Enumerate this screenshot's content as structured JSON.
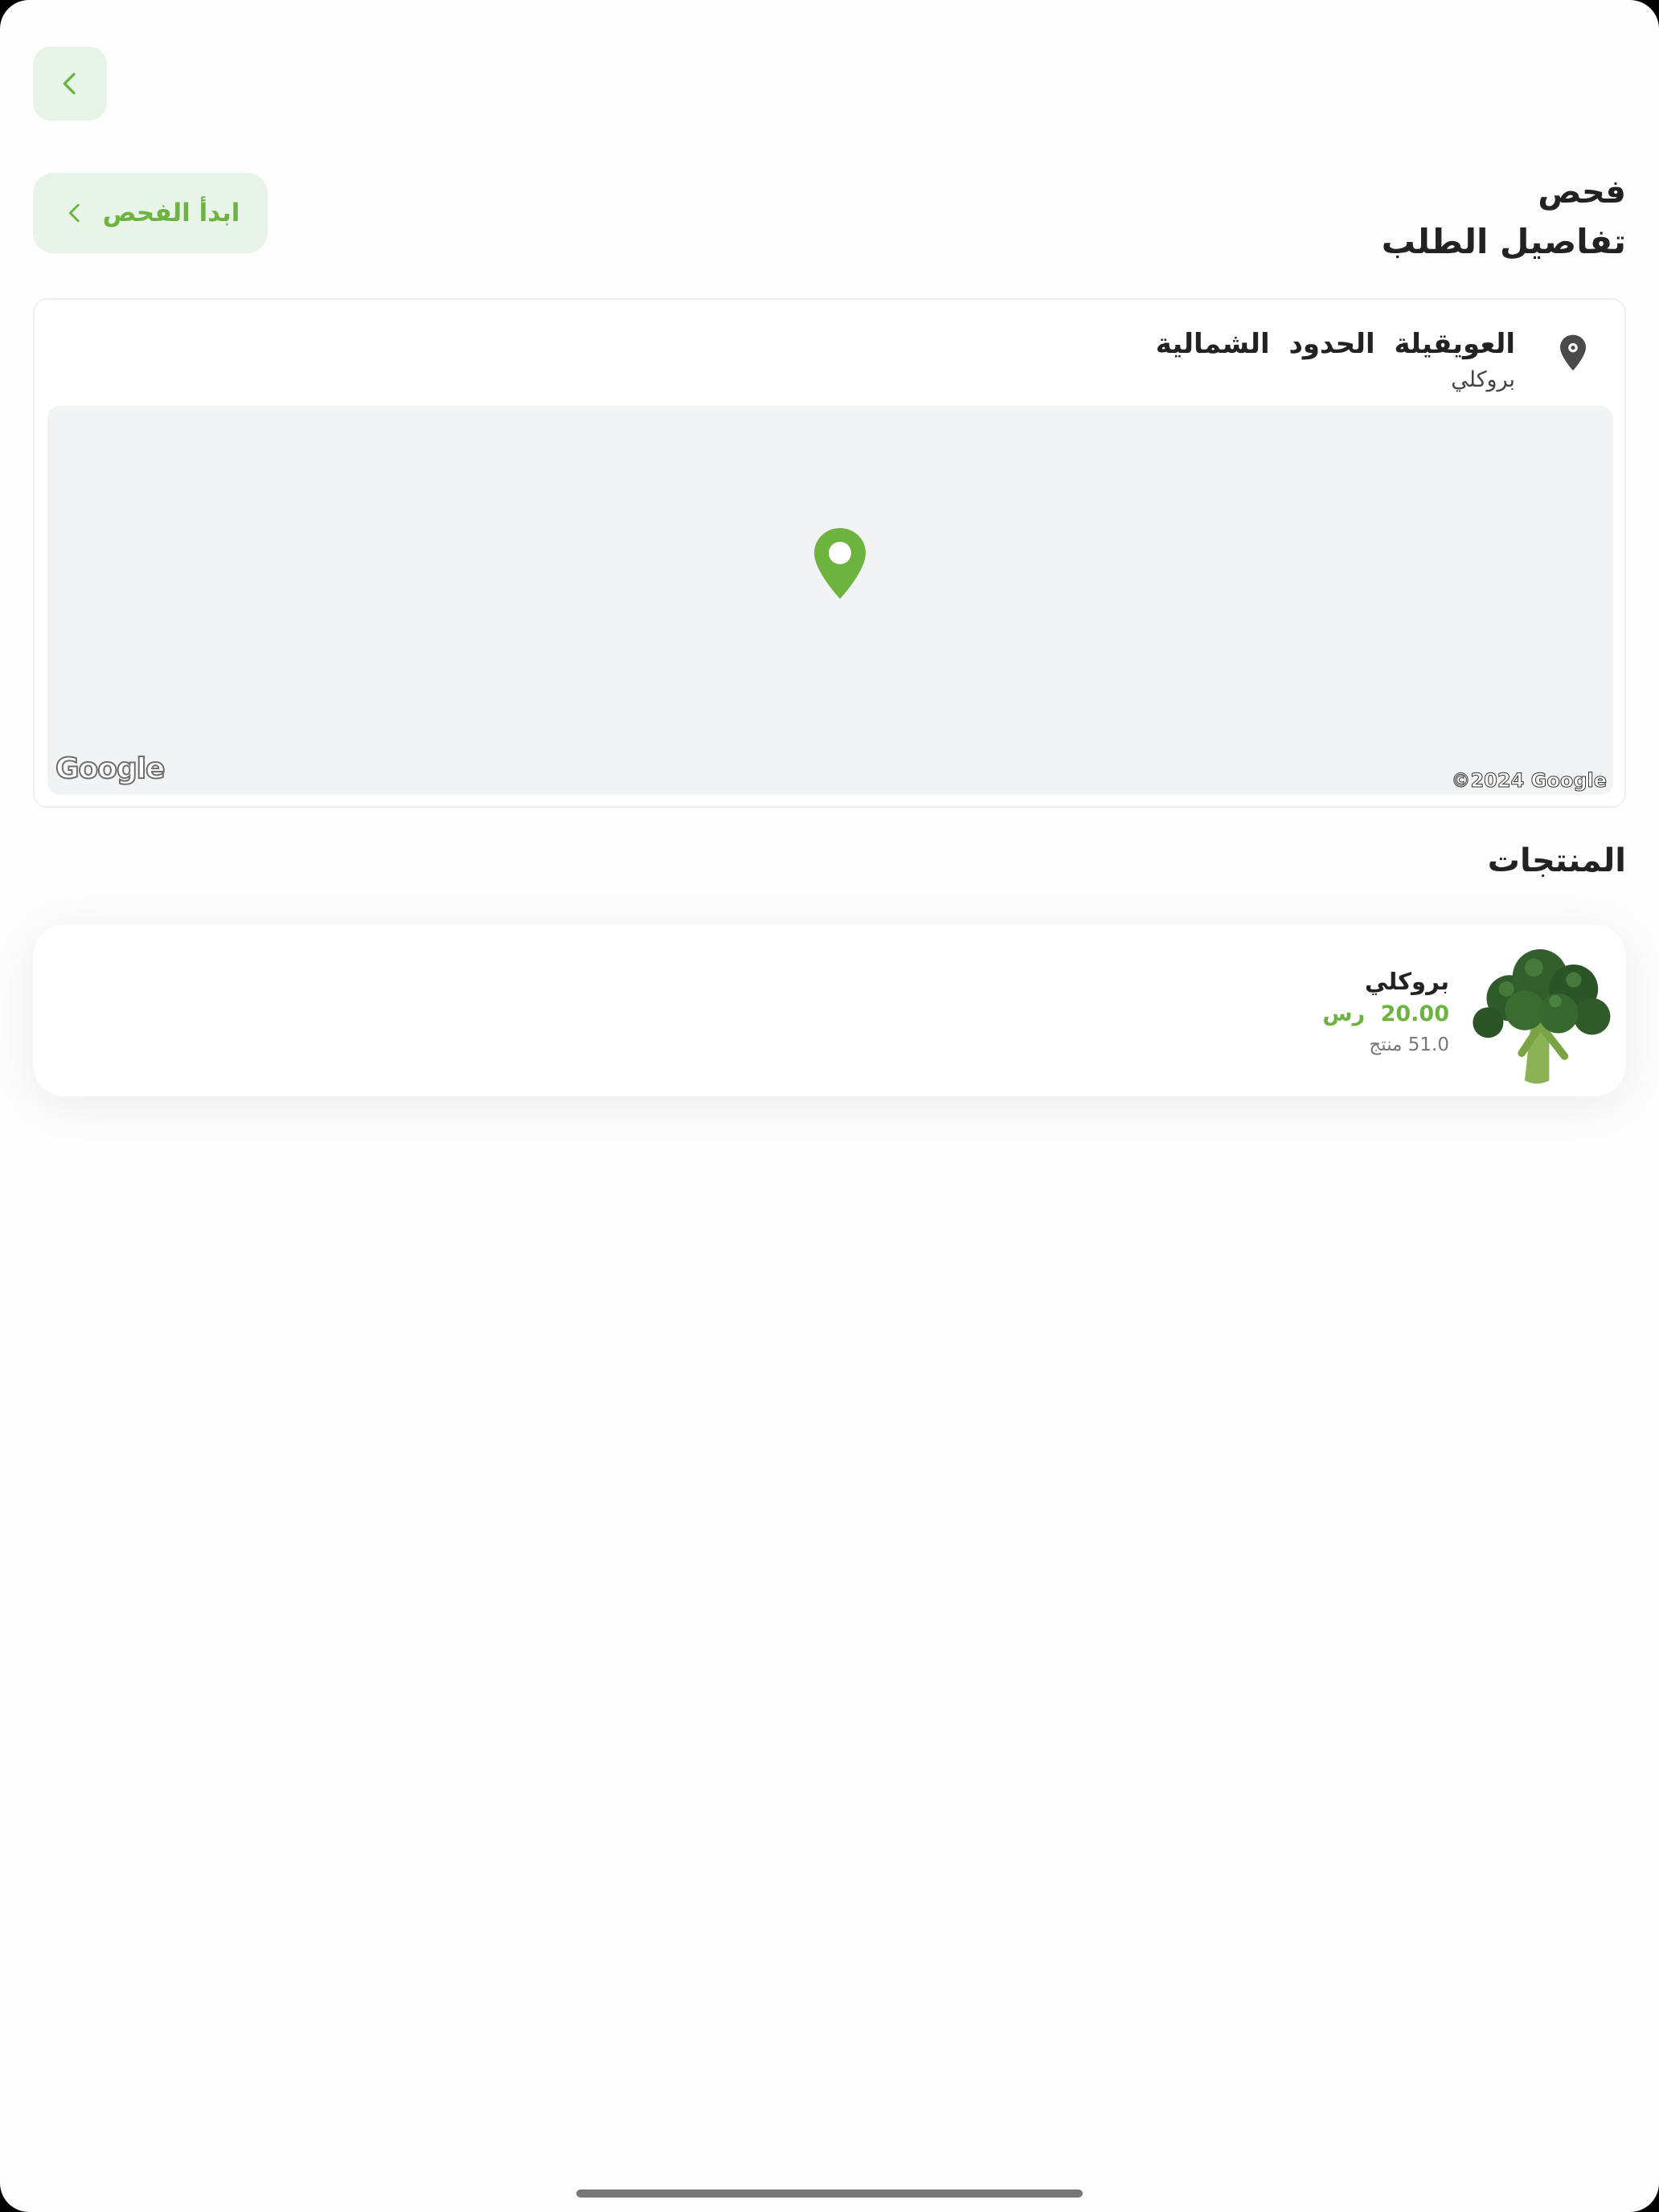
{
  "header": {
    "back_icon": "chevron-left-icon",
    "start_button_label": "ابدأ الفحص",
    "title_line1": "فحص",
    "title_line2": "تفاصيل الطلب"
  },
  "location": {
    "city": "العويقيلة الحدود الشمالية",
    "subtitle": "بروكلي",
    "pin_icon": "location-pin-icon",
    "map_logo": "Google",
    "map_copyright": "©2024 Google"
  },
  "products": {
    "title": "المنتجات",
    "items": [
      {
        "name": "بروكلي",
        "price": "20.00 رس",
        "quantity": "51.0 منتج",
        "image": "broccoli-image"
      }
    ]
  },
  "colors": {
    "accent": "#6db33f",
    "accent_bg": "#e8f4e8",
    "text": "#222222",
    "map_bg": "#f2f3f4"
  }
}
